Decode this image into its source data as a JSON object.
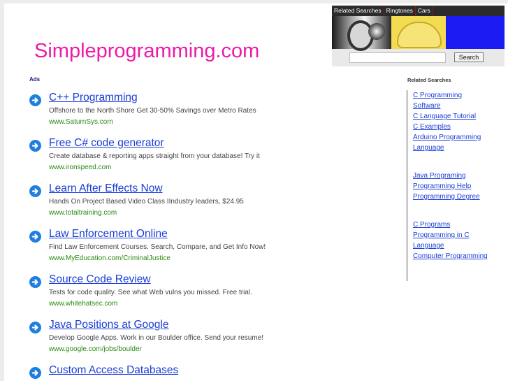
{
  "site": {
    "title": "Simpleprogramming.com"
  },
  "widget": {
    "tabs": [
      "Related Searches",
      "Ringtones",
      "Cars"
    ],
    "search_placeholder": "",
    "search_button": "Search"
  },
  "ads": {
    "label": "Ads",
    "items": [
      {
        "title": "C++ Programming",
        "desc": "Offshore to the North Shore Get 30-50% Savings over Metro Rates",
        "url": "www.SaturnSys.com"
      },
      {
        "title": "Free C# code generator",
        "desc": "Create database & reporting apps straight from your database! Try it",
        "url": "www.ironspeed.com"
      },
      {
        "title": "Learn After Effects Now",
        "desc": "Hands On Project Based Video Class IIndustry leaders, $24.95",
        "url": "www.totaltraining.com"
      },
      {
        "title": "Law Enforcement Online",
        "desc": "Find Law Enforcement Courses. Search, Compare, and Get Info Now!",
        "url": "www.MyEducation.com/CriminalJustice"
      },
      {
        "title": "Source Code Review",
        "desc": "Tests for code quality. See what Web vulns you missed. Free trial.",
        "url": "www.whitehatsec.com"
      },
      {
        "title": "Java Positions at Google",
        "desc": "Develop Google Apps. Work in our Boulder office. Send your resume!",
        "url": "www.google.com/jobs/boulder"
      },
      {
        "title": "Custom Access Databases",
        "desc": "",
        "url": ""
      }
    ]
  },
  "related": {
    "heading": "Related Searches",
    "links": [
      "C Programming",
      "Software",
      "C Language Tutorial",
      "C Examples",
      "Arduino Programming",
      "Language",
      "Java Programing",
      "Programming Help",
      "Programming Degree",
      "C Programs",
      "Programming in C",
      "Language",
      "Computer Programming"
    ]
  }
}
